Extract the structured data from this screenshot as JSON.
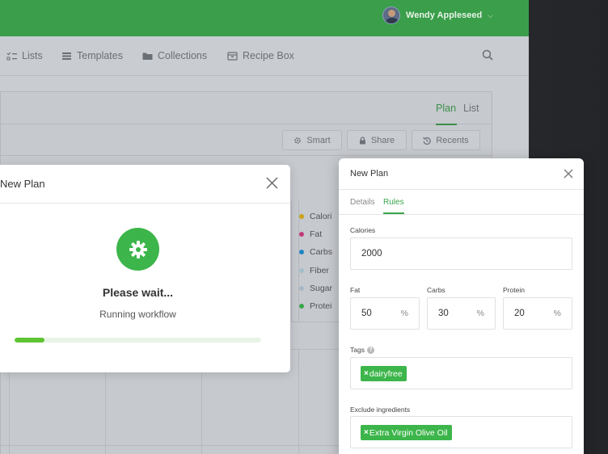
{
  "header": {
    "user_name": "Wendy Appleseed",
    "caret": "⌵"
  },
  "nav": {
    "items": [
      {
        "label": "Lists",
        "icon": "checklist-icon"
      },
      {
        "label": "Templates",
        "icon": "stack-icon"
      },
      {
        "label": "Collections",
        "icon": "folder-icon"
      },
      {
        "label": "Recipe Box",
        "icon": "box-icon"
      }
    ]
  },
  "panel": {
    "tabs": [
      {
        "label": "Plan",
        "active": true
      },
      {
        "label": "List",
        "active": false
      }
    ],
    "toolbar": {
      "smart": "Smart",
      "share": "Share",
      "recents": "Recents"
    },
    "legend": [
      {
        "label": "Calori",
        "color": "#c8a318"
      },
      {
        "label": "Fat",
        "color": "#c23a7a"
      },
      {
        "label": "Carbs",
        "color": "#1e86c5"
      },
      {
        "label": "Fiber",
        "color": "#a3bdc9"
      },
      {
        "label": "Sugar",
        "color": "#a8b6c4"
      },
      {
        "label": "Protei",
        "color": "#3aa64a"
      }
    ]
  },
  "progress_modal": {
    "title": "New Plan",
    "heading": "Please wait...",
    "subtitle": "Running workflow",
    "progress": 0.12
  },
  "plan_modal": {
    "title": "New Plan",
    "tabs": [
      {
        "label": "Details",
        "active": false
      },
      {
        "label": "Rules",
        "active": true
      }
    ],
    "calories": {
      "label": "Calories",
      "value": "2000"
    },
    "fat": {
      "label": "Fat",
      "value": "50",
      "unit": "%"
    },
    "carbs": {
      "label": "Carbs",
      "value": "30",
      "unit": "%"
    },
    "protein": {
      "label": "Protein",
      "value": "20",
      "unit": "%"
    },
    "tags": {
      "label": "Tags",
      "help": "?",
      "items": [
        "dairyfree"
      ]
    },
    "exclude": {
      "label": "Exclude ingredients",
      "items": [
        "Extra Virgin Olive Oil"
      ]
    },
    "tag_remove": "×"
  },
  "colors": {
    "brand_green": "#3cb54a",
    "topbar_green": "#3a9e4a"
  }
}
